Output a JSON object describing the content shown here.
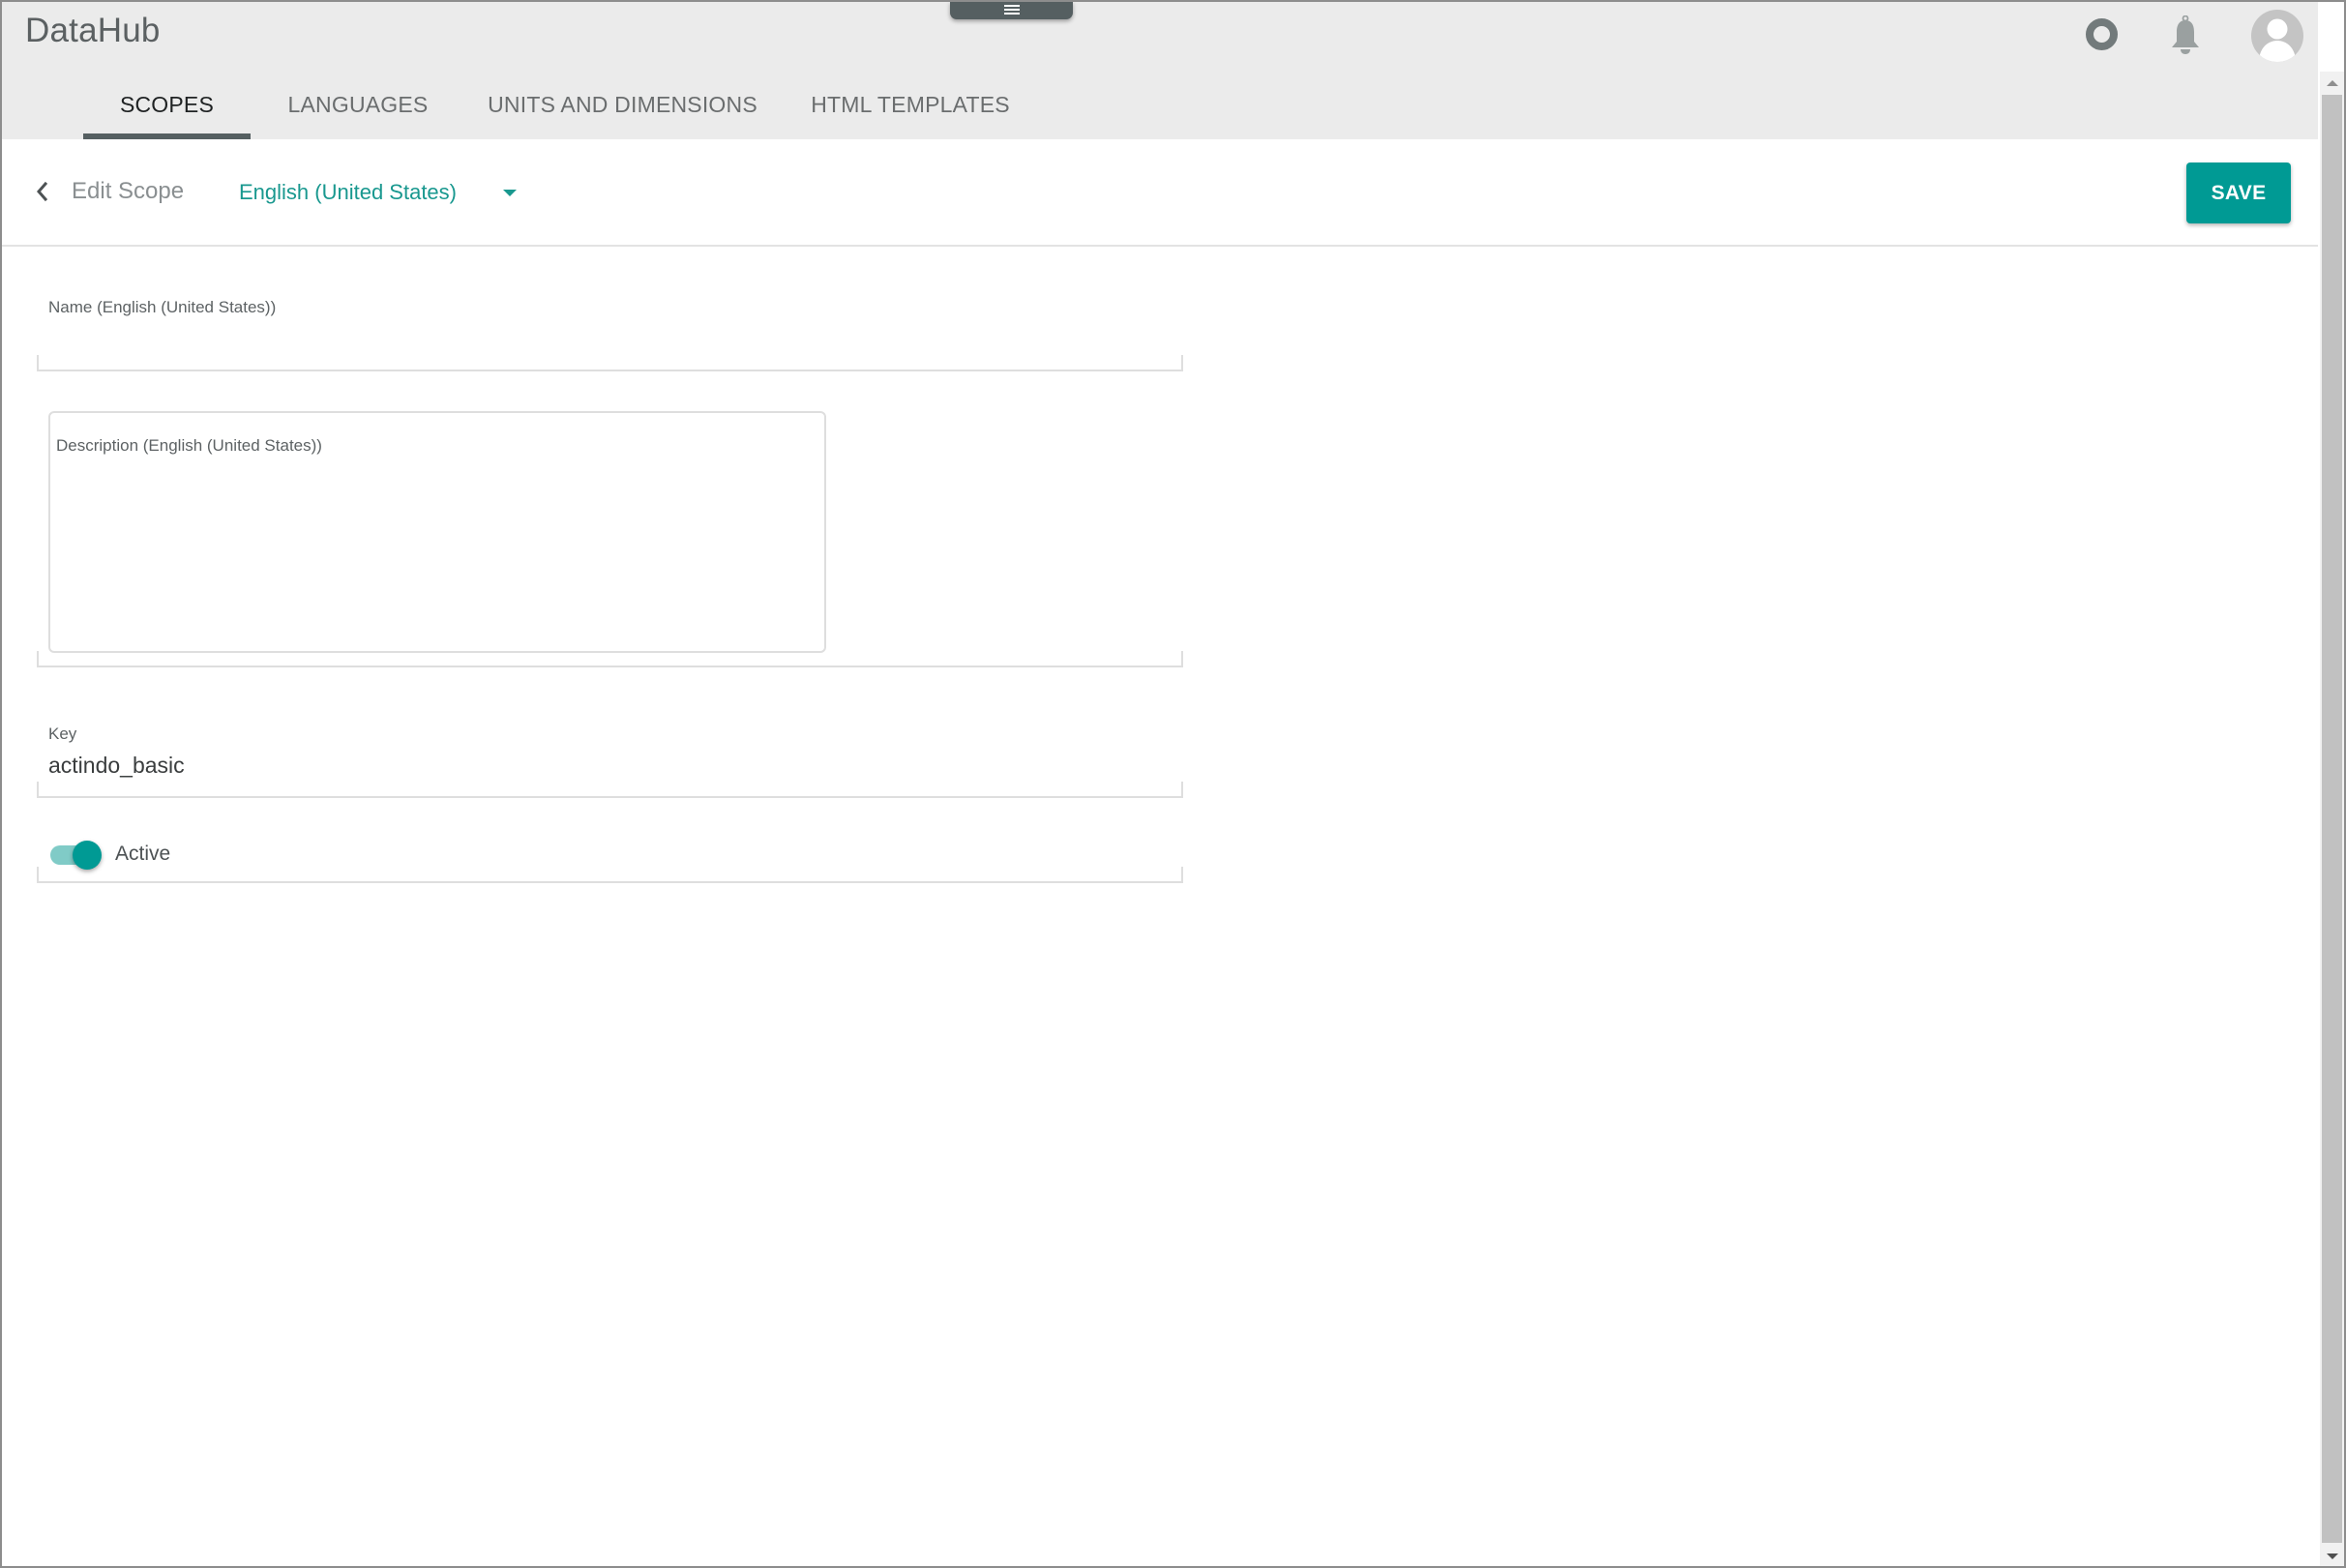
{
  "app": {
    "title": "DataHub"
  },
  "header": {
    "menu_icon": "hamburger-menu-icon",
    "icons": [
      {
        "name": "status-ring-icon"
      },
      {
        "name": "bell-icon"
      },
      {
        "name": "user-avatar-icon"
      }
    ],
    "tabs": [
      {
        "label": "SCOPES",
        "active": true
      },
      {
        "label": "LANGUAGES",
        "active": false
      },
      {
        "label": "UNITS AND DIMENSIONS",
        "active": false
      },
      {
        "label": "HTML TEMPLATES",
        "active": false
      }
    ]
  },
  "toolbar": {
    "back_icon": "chevron-left-icon",
    "title": "Edit Scope",
    "language": {
      "selected": "English (United States)",
      "icon": "caret-down-icon"
    },
    "save_label": "SAVE"
  },
  "form": {
    "name": {
      "label": "Name (English (United States))",
      "value": ""
    },
    "description": {
      "label": "Description (English (United States))",
      "value": ""
    },
    "key": {
      "label": "Key",
      "value": "actindo_basic"
    },
    "active": {
      "label": "Active",
      "checked": true
    }
  },
  "colors": {
    "accent": "#009a94",
    "accent_light": "#80cbc7",
    "header_bg": "#ebebeb",
    "tab_indicator": "#555f61"
  }
}
